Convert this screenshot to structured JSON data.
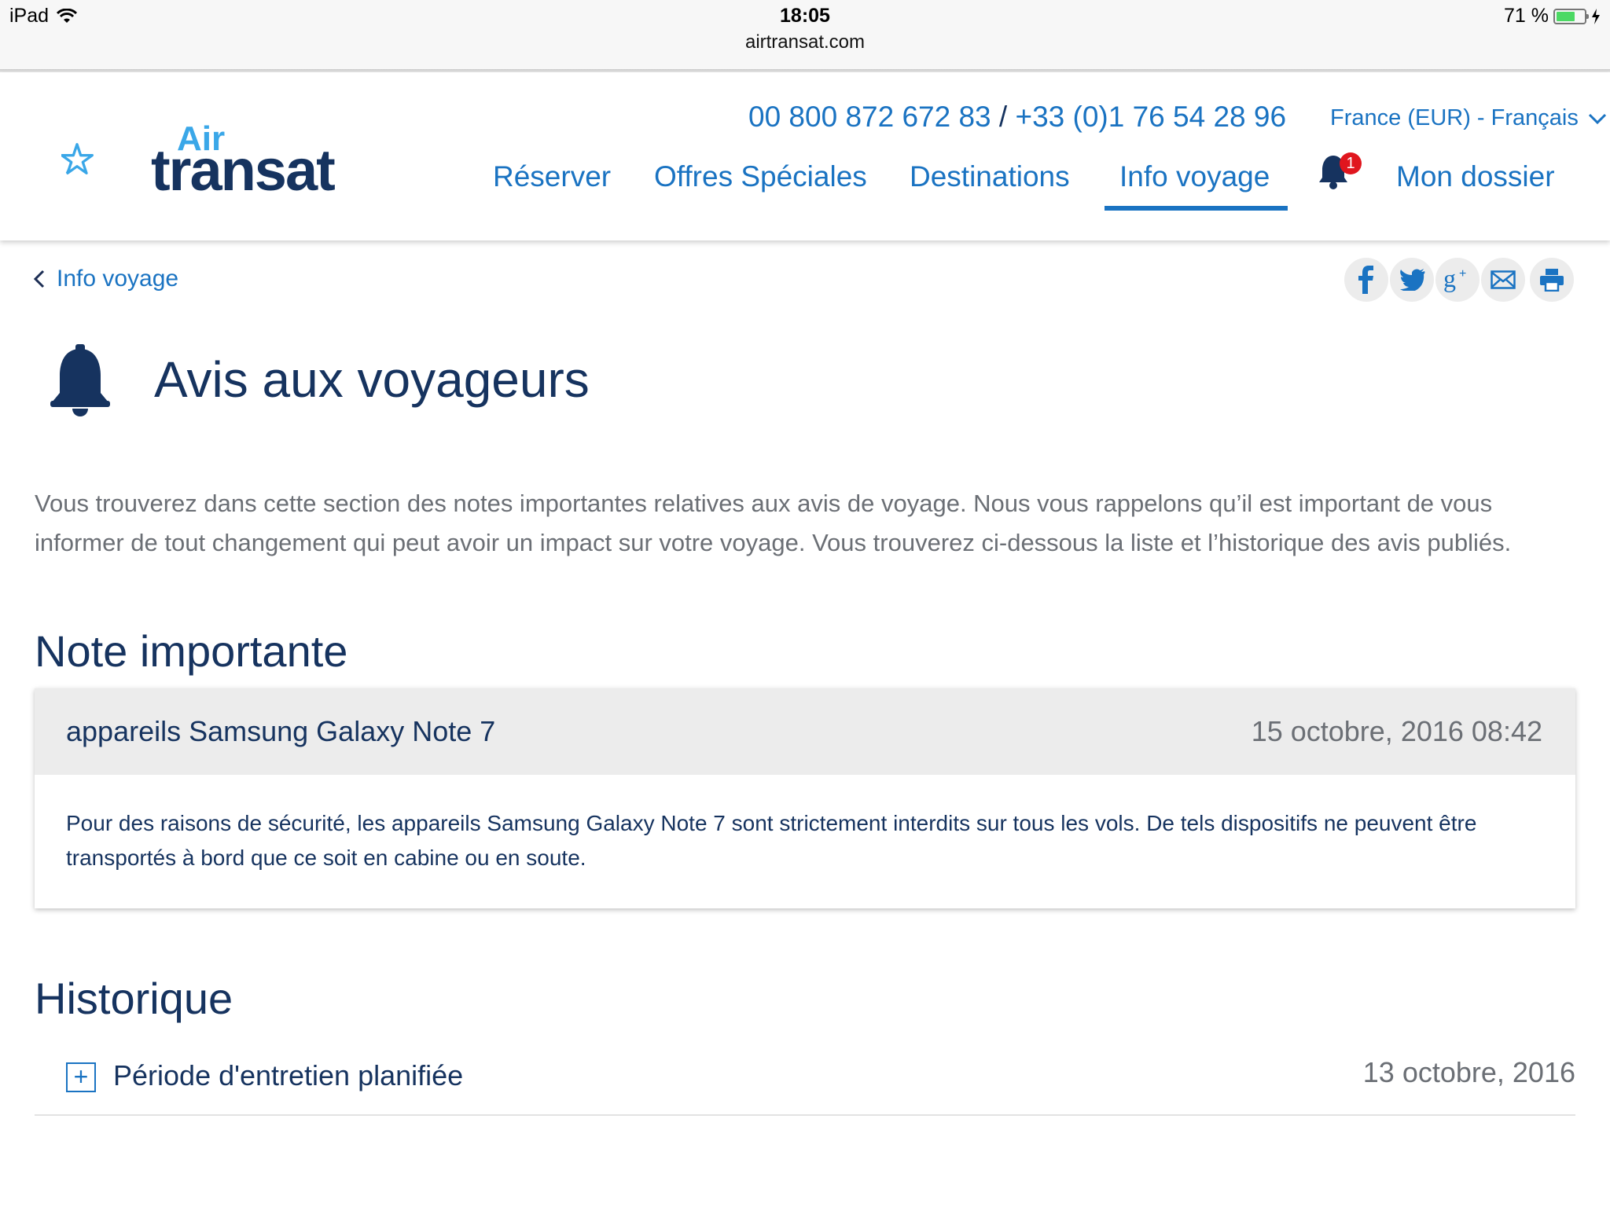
{
  "status_bar": {
    "device": "iPad",
    "time": "18:05",
    "url": "airtransat.com",
    "battery": "71 %",
    "battery_level": 0.71
  },
  "header": {
    "logo_air": "Air",
    "logo_transat": "transat",
    "phone_1": "00 800 872 672 83",
    "phone_sep": "/",
    "phone_2": "+33 (0)1 76 54 28 96",
    "lang": "France (EUR) - Français",
    "nav": {
      "reserver": "Réserver",
      "offres": "Offres Spéciales",
      "destinations": "Destinations",
      "info": "Info voyage",
      "dossier": "Mon dossier"
    },
    "notification_count": "1"
  },
  "breadcrumb": {
    "back_label": "Info voyage"
  },
  "share": {
    "icons": [
      "facebook-icon",
      "twitter-icon",
      "google-plus-icon",
      "email-icon",
      "print-icon"
    ]
  },
  "main": {
    "title": "Avis aux voyageurs",
    "intro": "Vous trouverez dans cette section des notes importantes relatives aux avis de voyage. Nous vous rappelons qu’il est important de vous informer de tout changement qui peut avoir un impact sur votre voyage. Vous trouverez ci-dessous la liste et l’historique des avis publiés.",
    "note_section_title": "Note importante",
    "note": {
      "title": "appareils Samsung Galaxy Note 7",
      "date": "15 octobre, 2016 08:42",
      "body": "Pour des raisons de sécurité, les appareils Samsung Galaxy Note 7 sont strictement interdits sur tous les vols. De tels dispositifs ne peuvent être transportés à bord que ce soit en cabine ou en soute."
    },
    "history_title": "Historique",
    "history": [
      {
        "title": "Période d'entretien planifiée",
        "date": "13 octobre, 2016",
        "expand": "+"
      }
    ]
  },
  "colors": {
    "brand_navy": "#16335f",
    "link_blue": "#1a73c2",
    "logo_light_blue": "#3aa7e8",
    "badge_red": "#e0161e",
    "battery_green": "#4cd964"
  }
}
